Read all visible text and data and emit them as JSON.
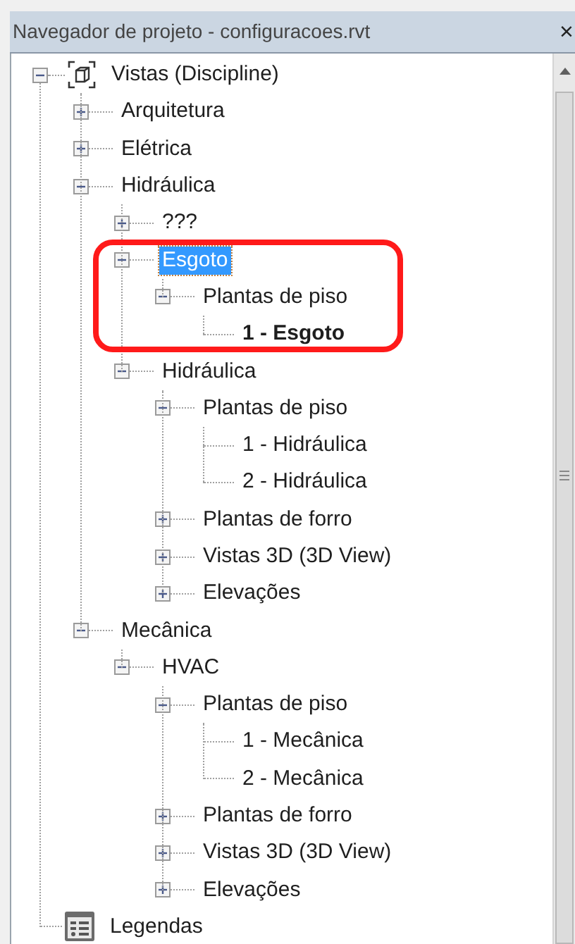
{
  "window": {
    "title": "Navegador de projeto - configuracoes.rvt",
    "close": "×"
  },
  "tree": [
    {
      "label": "Vistas (Discipline)",
      "kind": "views",
      "expanded": true,
      "selected": false,
      "children": [
        {
          "label": "Arquitetura",
          "expanded": false,
          "selected": false
        },
        {
          "label": "Elétrica",
          "expanded": false,
          "selected": false
        },
        {
          "label": "Hidráulica",
          "expanded": true,
          "selected": false,
          "children": [
            {
              "label": "???",
              "expanded": false,
              "selected": false
            },
            {
              "label": "Esgoto",
              "expanded": true,
              "selected": true,
              "children": [
                {
                  "label": "Plantas de piso",
                  "expanded": true,
                  "selected": false,
                  "children": [
                    {
                      "label": "1 - Esgoto",
                      "selected": false,
                      "bold": true
                    }
                  ]
                }
              ]
            },
            {
              "label": "Hidráulica",
              "expanded": true,
              "selected": false,
              "children": [
                {
                  "label": "Plantas de piso",
                  "expanded": true,
                  "selected": false,
                  "children": [
                    {
                      "label": "1 - Hidráulica",
                      "selected": false,
                      "bold": false
                    },
                    {
                      "label": "2 - Hidráulica",
                      "selected": false,
                      "bold": false
                    }
                  ]
                },
                {
                  "label": "Plantas de forro",
                  "expanded": false,
                  "selected": false
                },
                {
                  "label": "Vistas 3D (3D View)",
                  "expanded": false,
                  "selected": false
                },
                {
                  "label": "Elevações",
                  "expanded": false,
                  "selected": false
                }
              ]
            }
          ]
        },
        {
          "label": "Mecânica",
          "expanded": true,
          "selected": false,
          "children": [
            {
              "label": "HVAC",
              "expanded": true,
              "selected": false,
              "children": [
                {
                  "label": "Plantas de piso",
                  "expanded": true,
                  "selected": false,
                  "children": [
                    {
                      "label": "1 - Mecânica",
                      "selected": false,
                      "bold": false
                    },
                    {
                      "label": "2 - Mecânica",
                      "selected": false,
                      "bold": false
                    }
                  ]
                },
                {
                  "label": "Plantas de forro",
                  "expanded": false,
                  "selected": false
                },
                {
                  "label": "Vistas 3D (3D View)",
                  "expanded": false,
                  "selected": false
                },
                {
                  "label": "Elevações",
                  "expanded": false,
                  "selected": false
                }
              ]
            }
          ]
        }
      ]
    },
    {
      "label": "Legendas",
      "kind": "legend",
      "selected": false
    }
  ]
}
